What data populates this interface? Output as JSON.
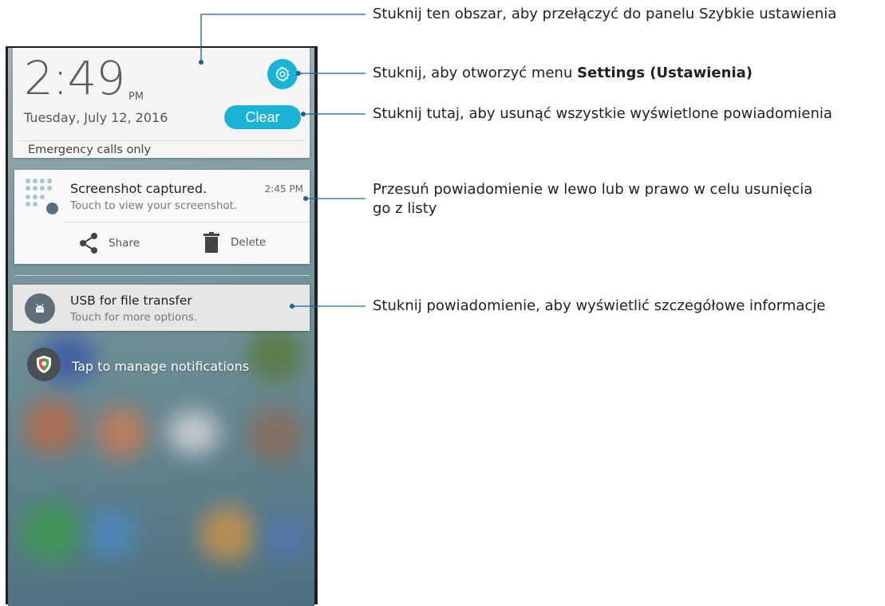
{
  "quick_panel": {
    "time": "2:49",
    "ampm": "PM",
    "date": "Tuesday, July 12, 2016",
    "clear_label": "Clear",
    "emergency_text": "Emergency calls only"
  },
  "notifications": [
    {
      "title": "Screenshot captured.",
      "time": "2:45 PM",
      "text": "Touch to view your screenshot.",
      "actions": [
        {
          "label": "Share",
          "icon": "share-icon"
        },
        {
          "label": "Delete",
          "icon": "trash-icon"
        }
      ]
    },
    {
      "title": "USB for file transfer",
      "text": "Touch for more options.",
      "icon": "android-icon"
    }
  ],
  "manage": {
    "label": "Tap to manage notifications",
    "icon": "shield-icon"
  },
  "callouts": {
    "quick_settings": "Stuknij ten obszar, aby przełączyć do panelu Szybkie ustawienia",
    "settings_prefix": "Stuknij, aby otworzyć menu ",
    "settings_bold": "Settings (Ustawienia)",
    "clear": "Stuknij tutaj, aby usunąć wszystkie wyświetlone powiadomienia",
    "swipe_line1": "Przesuń powiadomienie w lewo lub w prawo w celu usunięcia",
    "swipe_line2": "go z listy",
    "tap_details": "Stuknij powiadomienie, aby wyświetlić szczegółowe informacje"
  },
  "colors": {
    "accent": "#1ab3d3",
    "callout_line": "#1f5f9c"
  }
}
